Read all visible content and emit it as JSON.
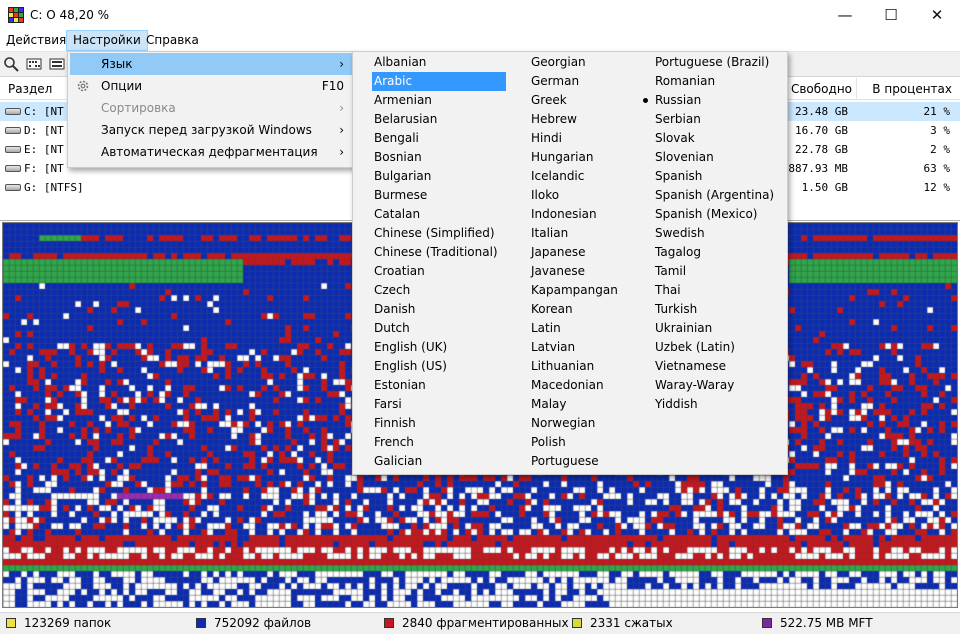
{
  "window": {
    "title": "C:  O  48,20 %",
    "minimize": "—",
    "maximize": "☐",
    "close": "✕"
  },
  "menubar": [
    "Действия",
    "Настройки",
    "Справка"
  ],
  "settings_menu": [
    {
      "label": "Язык",
      "right": "›",
      "highlight": true,
      "disabled": false,
      "icon": ""
    },
    {
      "label": "Опции",
      "right": "F10",
      "highlight": false,
      "disabled": false,
      "icon": "gear-icon"
    },
    {
      "label": "Сортировка",
      "right": "›",
      "highlight": false,
      "disabled": true,
      "icon": ""
    },
    {
      "label": "Запуск перед загрузкой Windows",
      "right": "›",
      "highlight": false,
      "disabled": false,
      "icon": ""
    },
    {
      "label": "Автоматическая дефрагментация",
      "right": "›",
      "highlight": false,
      "disabled": false,
      "icon": ""
    }
  ],
  "languages": {
    "col1": [
      "Albanian",
      "Arabic",
      "Armenian",
      "Belarusian",
      "Bengali",
      "Bosnian",
      "Bulgarian",
      "Burmese",
      "Catalan",
      "Chinese (Simplified)",
      "Chinese (Traditional)",
      "Croatian",
      "Czech",
      "Danish",
      "Dutch",
      "English (UK)",
      "English (US)",
      "Estonian",
      "Farsi",
      "Finnish",
      "French",
      "Galician"
    ],
    "col2": [
      "Georgian",
      "German",
      "Greek",
      "Hebrew",
      "Hindi",
      "Hungarian",
      "Icelandic",
      "Iloko",
      "Indonesian",
      "Italian",
      "Japanese",
      "Javanese",
      "Kapampangan",
      "Korean",
      "Latin",
      "Latvian",
      "Lithuanian",
      "Macedonian",
      "Malay",
      "Norwegian",
      "Polish",
      "Portuguese"
    ],
    "col3": [
      "Portuguese (Brazil)",
      "Romanian",
      "Russian",
      "Serbian",
      "Slovak",
      "Slovenian",
      "Spanish",
      "Spanish (Argentina)",
      "Spanish (Mexico)",
      "Swedish",
      "Tagalog",
      "Tamil",
      "Thai",
      "Turkish",
      "Ukrainian",
      "Uzbek (Latin)",
      "Vietnamese",
      "Waray-Waray",
      "Yiddish"
    ],
    "highlighted": "Arabic",
    "selected": "Russian"
  },
  "table": {
    "headers": {
      "partition": "Раздел",
      "free": "Свободно",
      "percent": "В процентах"
    },
    "rows": [
      {
        "drive": "C:  [NT",
        "free": "23.48 GB",
        "percent": "21 %",
        "selected": true
      },
      {
        "drive": "D:  [NT",
        "free": "16.70 GB",
        "percent": "3 %",
        "selected": false
      },
      {
        "drive": "E:  [NT",
        "free": "22.78 GB",
        "percent": "2 %",
        "selected": false
      },
      {
        "drive": "F:  [NT",
        "free": "887.93 MB",
        "percent": "63 %",
        "selected": false
      },
      {
        "drive": "G:  [NTFS]",
        "free": "1.50 GB",
        "percent": "12 %",
        "selected": false
      }
    ]
  },
  "colors": {
    "free": "#ffffff",
    "used": "#0a2bb5",
    "fragmented": "#c8161d",
    "compressed": "#2ea84a",
    "mft": "#9b2bb5",
    "grid_line": "#4a4a4a",
    "status_folders": "#f0e040",
    "status_files": "#0a2bb5",
    "status_frag": "#c8161d",
    "status_comp": "#d8d840",
    "status_mft": "#7a2a9a"
  },
  "statusbar": [
    {
      "text": "123269 папок",
      "color": "#f0e040"
    },
    {
      "text": "752092 файлов",
      "color": "#0a2bb5"
    },
    {
      "text": "2840 фрагментированных",
      "color": "#c8161d"
    },
    {
      "text": "2331 сжатых",
      "color": "#d8d840"
    },
    {
      "text": "522.75 MB MFT",
      "color": "#7a2a9a"
    }
  ]
}
